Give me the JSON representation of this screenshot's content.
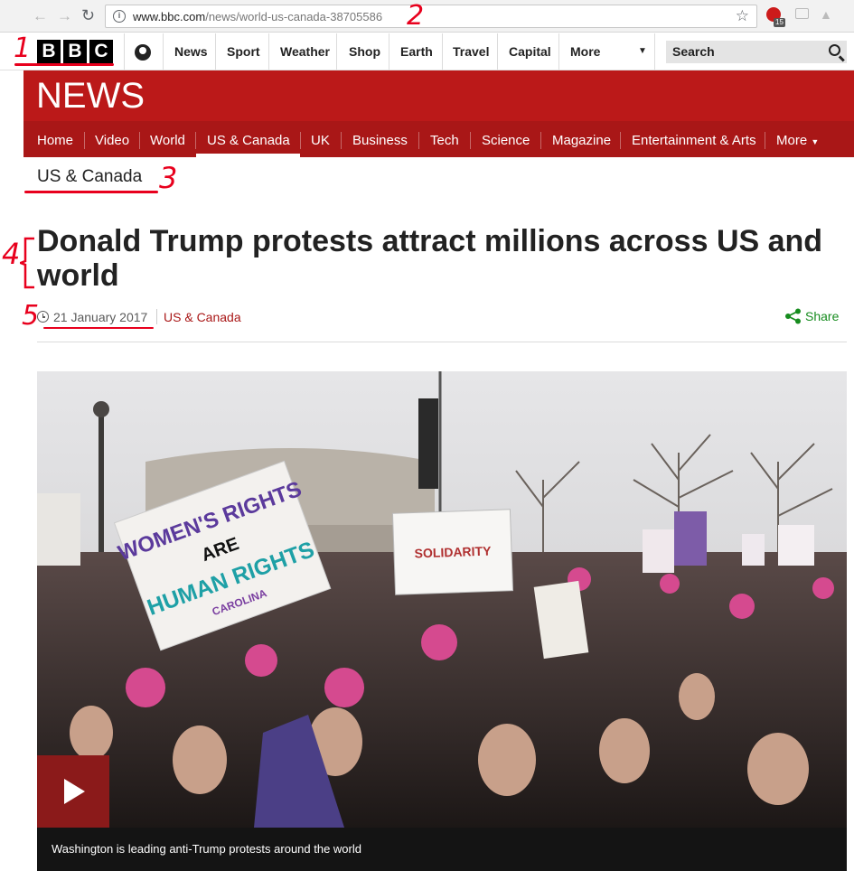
{
  "browser": {
    "url_host": "www.bbc.com",
    "url_path": "/news/world-us-canada-38705586",
    "extension_badge": "15"
  },
  "annotations": [
    "1",
    "2",
    "3",
    "4",
    "5"
  ],
  "masthead": {
    "logo_letters": [
      "B",
      "B",
      "C"
    ],
    "links": [
      "News",
      "Sport",
      "Weather",
      "Shop",
      "Earth",
      "Travel",
      "Capital",
      "More"
    ],
    "search_label": "Search"
  },
  "news_banner": {
    "title": "NEWS"
  },
  "section_nav": {
    "items": [
      "Home",
      "Video",
      "World",
      "US & Canada",
      "UK",
      "Business",
      "Tech",
      "Science",
      "Magazine",
      "Entertainment & Arts",
      "More"
    ],
    "active": "US & Canada"
  },
  "section_title": "US & Canada",
  "article": {
    "headline": "Donald Trump protests attract millions across US and world",
    "date": "21 January 2017",
    "section": "US & Canada",
    "share_label": "Share"
  },
  "media": {
    "signs": [
      "WOMEN'S RIGHTS",
      "ARE",
      "HUMAN RIGHTS",
      "CAROLINA",
      "SOLIDARITY"
    ],
    "caption": "Washington is leading anti-Trump protests around the world"
  },
  "colors": {
    "bbc_red": "#bb1919",
    "nav_red": "#a91717",
    "share_green": "#178c1f",
    "annotation_red": "#e8001d"
  }
}
